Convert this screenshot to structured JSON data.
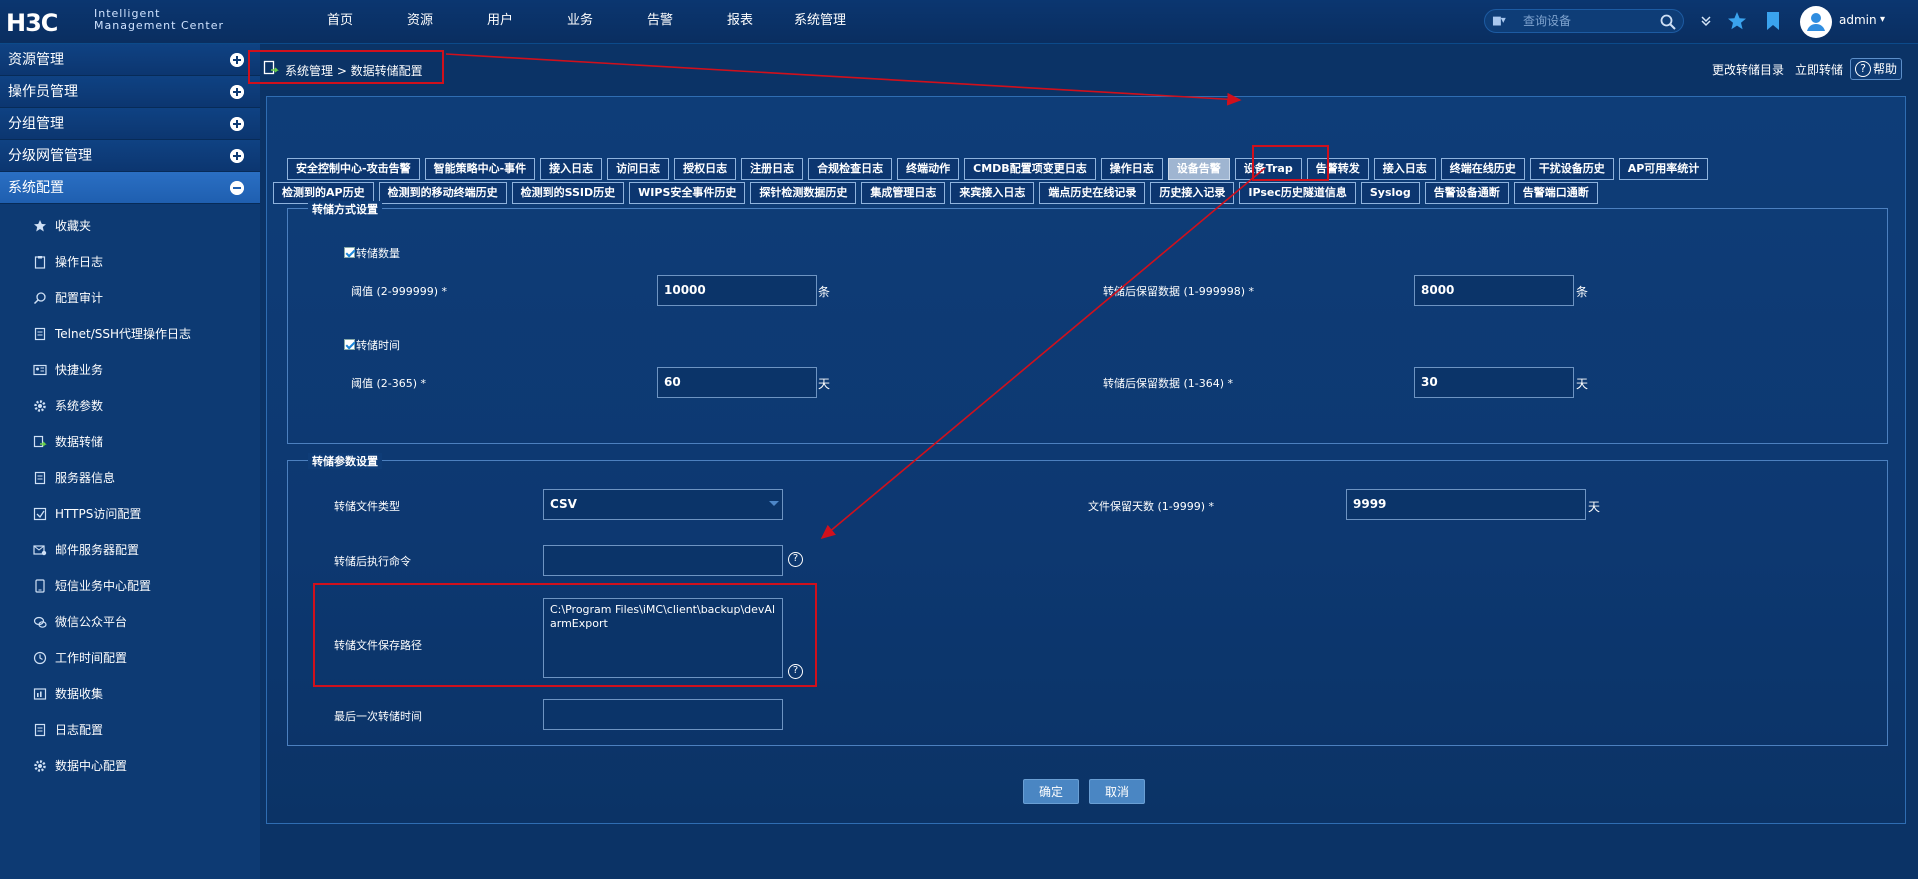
{
  "header": {
    "logo_main": "H3C",
    "logo_sub_line1": "Intelligent",
    "logo_sub_line2": "Management Center",
    "nav": [
      "首页",
      "资源",
      "用户",
      "业务",
      "告警",
      "报表",
      "系统管理"
    ],
    "search_placeholder": "查询设备",
    "user": "admin"
  },
  "sidebar": {
    "groups": [
      {
        "label": "资源管理",
        "expanded": false
      },
      {
        "label": "操作员管理",
        "expanded": false
      },
      {
        "label": "分组管理",
        "expanded": false
      },
      {
        "label": "分级网管管理",
        "expanded": false
      },
      {
        "label": "系统配置",
        "expanded": true
      }
    ],
    "items": [
      {
        "label": "收藏夹",
        "icon": "star-icon"
      },
      {
        "label": "操作日志",
        "icon": "clipboard-icon"
      },
      {
        "label": "配置审计",
        "icon": "magnifier-icon"
      },
      {
        "label": "Telnet/SSH代理操作日志",
        "icon": "document-icon"
      },
      {
        "label": "快捷业务",
        "icon": "id-card-icon"
      },
      {
        "label": "系统参数",
        "icon": "gear-icon"
      },
      {
        "label": "数据转储",
        "icon": "data-dump-icon"
      },
      {
        "label": "服务器信息",
        "icon": "server-icon"
      },
      {
        "label": "HTTPS访问配置",
        "icon": "https-icon"
      },
      {
        "label": "邮件服务器配置",
        "icon": "mail-server-icon"
      },
      {
        "label": "短信业务中心配置",
        "icon": "sms-icon"
      },
      {
        "label": "微信公众平台",
        "icon": "wechat-icon"
      },
      {
        "label": "工作时间配置",
        "icon": "clock-icon"
      },
      {
        "label": "数据收集",
        "icon": "data-collect-icon"
      },
      {
        "label": "日志配置",
        "icon": "log-config-icon"
      },
      {
        "label": "数据中心配置",
        "icon": "datacenter-gear-icon"
      }
    ]
  },
  "breadcrumb": "系统管理 > 数据转储配置",
  "top_links": {
    "change_dir": "更改转储目录",
    "dump_now": "立即转储",
    "help": "帮助"
  },
  "tabs_row1": [
    "安全控制中心-攻击告警",
    "智能策略中心-事件",
    "接入日志",
    "访问日志",
    "授权日志",
    "注册日志",
    "合规检查日志",
    "终端动作",
    "CMDB配置项变更日志",
    "操作日志",
    "设备告警",
    "设备Trap",
    "告警转发",
    "接入日志",
    "终端在线历史",
    "干扰设备历史",
    "AP可用率统计"
  ],
  "tabs_row2": [
    "检测到的AP历史",
    "检测到的移动终端历史",
    "检测到的SSID历史",
    "WIPS安全事件历史",
    "探针检测数据历史",
    "集成管理日志",
    "来宾接入日志",
    "端点历史在线记录",
    "历史接入记录",
    "IPsec历史隧道信息",
    "Syslog",
    "告警设备通断",
    "告警端口通断"
  ],
  "active_tab": "设备告警",
  "dump_mode": {
    "legend": "转储方式设置",
    "by_count": {
      "label": "转储数量",
      "threshold_label": "阈值 (2-999999) *",
      "threshold_value": "10000",
      "threshold_unit": "条",
      "keep_label": "转储后保留数据 (1-999998) *",
      "keep_value": "8000",
      "keep_unit": "条"
    },
    "by_time": {
      "label": "转储时间",
      "threshold_label": "阈值 (2-365) *",
      "threshold_value": "60",
      "threshold_unit": "天",
      "keep_label": "转储后保留数据 (1-364) *",
      "keep_value": "30",
      "keep_unit": "天"
    }
  },
  "dump_params": {
    "legend": "转储参数设置",
    "file_type_label": "转储文件类型",
    "file_type_value": "CSV",
    "retain_days_label": "文件保留天数 (1-9999) *",
    "retain_days_value": "9999",
    "retain_days_unit": "天",
    "post_cmd_label": "转储后执行命令",
    "post_cmd_value": "",
    "path_label": "转储文件保存路径",
    "path_value": "C:\\Program Files\\iMC\\client\\backup\\devAlarmExport",
    "last_time_label": "最后一次转储时间",
    "last_time_value": ""
  },
  "buttons": {
    "ok": "确定",
    "cancel": "取消"
  },
  "colors": {
    "annotation": "#d0101c",
    "background": "#0b3366"
  }
}
